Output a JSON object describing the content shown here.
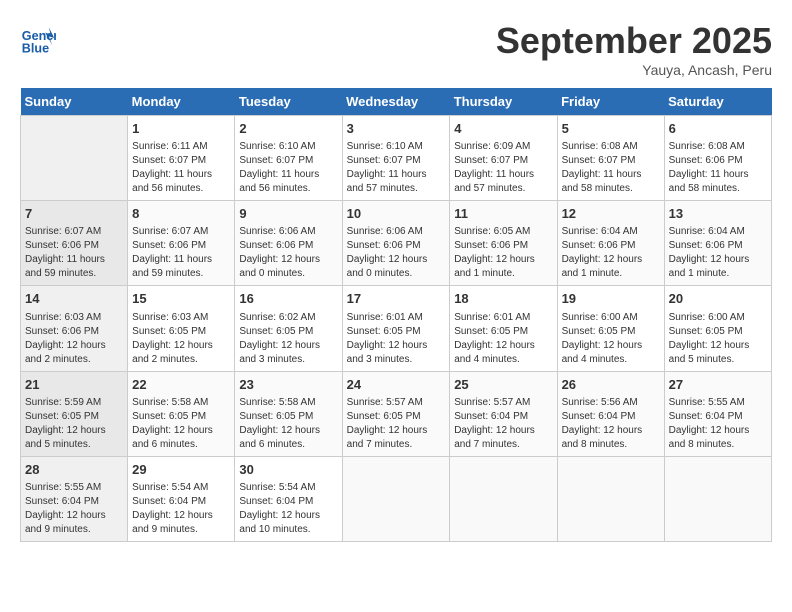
{
  "header": {
    "logo_text_general": "General",
    "logo_text_blue": "Blue",
    "month": "September 2025",
    "location": "Yauya, Ancash, Peru"
  },
  "days_of_week": [
    "Sunday",
    "Monday",
    "Tuesday",
    "Wednesday",
    "Thursday",
    "Friday",
    "Saturday"
  ],
  "weeks": [
    [
      {
        "day": "",
        "info": ""
      },
      {
        "day": "1",
        "info": "Sunrise: 6:11 AM\nSunset: 6:07 PM\nDaylight: 11 hours\nand 56 minutes."
      },
      {
        "day": "2",
        "info": "Sunrise: 6:10 AM\nSunset: 6:07 PM\nDaylight: 11 hours\nand 56 minutes."
      },
      {
        "day": "3",
        "info": "Sunrise: 6:10 AM\nSunset: 6:07 PM\nDaylight: 11 hours\nand 57 minutes."
      },
      {
        "day": "4",
        "info": "Sunrise: 6:09 AM\nSunset: 6:07 PM\nDaylight: 11 hours\nand 57 minutes."
      },
      {
        "day": "5",
        "info": "Sunrise: 6:08 AM\nSunset: 6:07 PM\nDaylight: 11 hours\nand 58 minutes."
      },
      {
        "day": "6",
        "info": "Sunrise: 6:08 AM\nSunset: 6:06 PM\nDaylight: 11 hours\nand 58 minutes."
      }
    ],
    [
      {
        "day": "7",
        "info": "Sunrise: 6:07 AM\nSunset: 6:06 PM\nDaylight: 11 hours\nand 59 minutes."
      },
      {
        "day": "8",
        "info": "Sunrise: 6:07 AM\nSunset: 6:06 PM\nDaylight: 11 hours\nand 59 minutes."
      },
      {
        "day": "9",
        "info": "Sunrise: 6:06 AM\nSunset: 6:06 PM\nDaylight: 12 hours\nand 0 minutes."
      },
      {
        "day": "10",
        "info": "Sunrise: 6:06 AM\nSunset: 6:06 PM\nDaylight: 12 hours\nand 0 minutes."
      },
      {
        "day": "11",
        "info": "Sunrise: 6:05 AM\nSunset: 6:06 PM\nDaylight: 12 hours\nand 1 minute."
      },
      {
        "day": "12",
        "info": "Sunrise: 6:04 AM\nSunset: 6:06 PM\nDaylight: 12 hours\nand 1 minute."
      },
      {
        "day": "13",
        "info": "Sunrise: 6:04 AM\nSunset: 6:06 PM\nDaylight: 12 hours\nand 1 minute."
      }
    ],
    [
      {
        "day": "14",
        "info": "Sunrise: 6:03 AM\nSunset: 6:06 PM\nDaylight: 12 hours\nand 2 minutes."
      },
      {
        "day": "15",
        "info": "Sunrise: 6:03 AM\nSunset: 6:05 PM\nDaylight: 12 hours\nand 2 minutes."
      },
      {
        "day": "16",
        "info": "Sunrise: 6:02 AM\nSunset: 6:05 PM\nDaylight: 12 hours\nand 3 minutes."
      },
      {
        "day": "17",
        "info": "Sunrise: 6:01 AM\nSunset: 6:05 PM\nDaylight: 12 hours\nand 3 minutes."
      },
      {
        "day": "18",
        "info": "Sunrise: 6:01 AM\nSunset: 6:05 PM\nDaylight: 12 hours\nand 4 minutes."
      },
      {
        "day": "19",
        "info": "Sunrise: 6:00 AM\nSunset: 6:05 PM\nDaylight: 12 hours\nand 4 minutes."
      },
      {
        "day": "20",
        "info": "Sunrise: 6:00 AM\nSunset: 6:05 PM\nDaylight: 12 hours\nand 5 minutes."
      }
    ],
    [
      {
        "day": "21",
        "info": "Sunrise: 5:59 AM\nSunset: 6:05 PM\nDaylight: 12 hours\nand 5 minutes."
      },
      {
        "day": "22",
        "info": "Sunrise: 5:58 AM\nSunset: 6:05 PM\nDaylight: 12 hours\nand 6 minutes."
      },
      {
        "day": "23",
        "info": "Sunrise: 5:58 AM\nSunset: 6:05 PM\nDaylight: 12 hours\nand 6 minutes."
      },
      {
        "day": "24",
        "info": "Sunrise: 5:57 AM\nSunset: 6:05 PM\nDaylight: 12 hours\nand 7 minutes."
      },
      {
        "day": "25",
        "info": "Sunrise: 5:57 AM\nSunset: 6:04 PM\nDaylight: 12 hours\nand 7 minutes."
      },
      {
        "day": "26",
        "info": "Sunrise: 5:56 AM\nSunset: 6:04 PM\nDaylight: 12 hours\nand 8 minutes."
      },
      {
        "day": "27",
        "info": "Sunrise: 5:55 AM\nSunset: 6:04 PM\nDaylight: 12 hours\nand 8 minutes."
      }
    ],
    [
      {
        "day": "28",
        "info": "Sunrise: 5:55 AM\nSunset: 6:04 PM\nDaylight: 12 hours\nand 9 minutes."
      },
      {
        "day": "29",
        "info": "Sunrise: 5:54 AM\nSunset: 6:04 PM\nDaylight: 12 hours\nand 9 minutes."
      },
      {
        "day": "30",
        "info": "Sunrise: 5:54 AM\nSunset: 6:04 PM\nDaylight: 12 hours\nand 10 minutes."
      },
      {
        "day": "",
        "info": ""
      },
      {
        "day": "",
        "info": ""
      },
      {
        "day": "",
        "info": ""
      },
      {
        "day": "",
        "info": ""
      }
    ]
  ]
}
